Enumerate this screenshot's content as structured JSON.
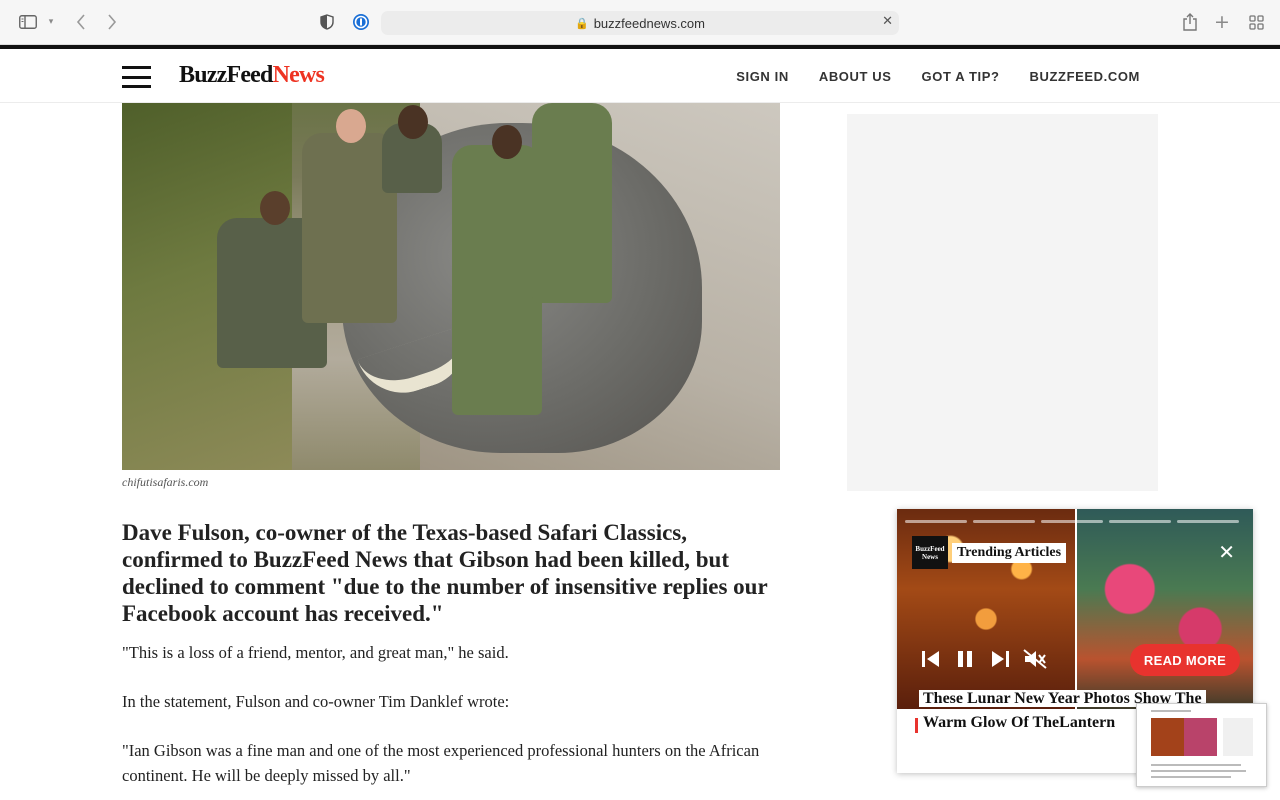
{
  "browser": {
    "url": "buzzfeednews.com"
  },
  "header": {
    "logo": {
      "part1": "BuzzFeed",
      "part2": "News"
    },
    "nav": [
      "SIGN IN",
      "ABOUT US",
      "GOT A TIP?",
      "BUZZFEED.COM"
    ]
  },
  "article": {
    "photo_credit": "chifutisafaris.com",
    "lead": "Dave Fulson, co-owner of the Texas-based Safari Classics, confirmed to BuzzFeed News that Gibson had been killed, but declined to comment \"due to the number of insensitive replies our Facebook account has received.\"",
    "paragraphs": [
      "\"This is a loss of a friend, mentor, and great man,\" he said.",
      "In the statement, Fulson and co-owner Tim Danklef wrote:",
      "\"Ian Gibson was a fine man and one of the most experienced professional hunters on the African continent. He will be deeply missed by all.\""
    ]
  },
  "widget": {
    "badge": "BuzzFeed News",
    "label": "Trending Articles",
    "read_more": "READ MORE",
    "headline": "These Lunar New Year Photos Show The Warm Glow Of TheLantern"
  },
  "colors": {
    "accent": "#e8332e",
    "logo_dot": "#e32222"
  },
  "icons": [
    "sidebar-icon",
    "chevron-down-icon",
    "back-icon",
    "forward-icon",
    "privacy-shield-icon",
    "password-icon",
    "lock-icon",
    "clear-icon",
    "share-icon",
    "new-tab-icon",
    "tab-overview-icon",
    "menu-icon",
    "skip-back-icon",
    "pause-icon",
    "skip-forward-icon",
    "mute-icon",
    "close-icon"
  ]
}
